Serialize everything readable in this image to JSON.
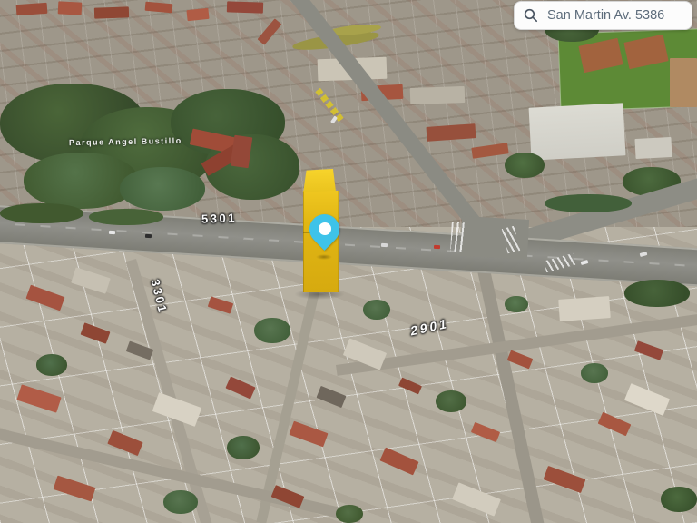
{
  "search": {
    "icon": "search-icon",
    "value": "San Martin Av. 5386"
  },
  "map": {
    "labels": {
      "avenue_block": "5301",
      "left_street_block": "3301",
      "right_street_block": "2901",
      "park": "Parque Angel Bustillo"
    },
    "marker": {
      "type": "location-pin",
      "pin_color": "#3EC3E9"
    },
    "highlighted_building_color": "#E2B71A"
  }
}
